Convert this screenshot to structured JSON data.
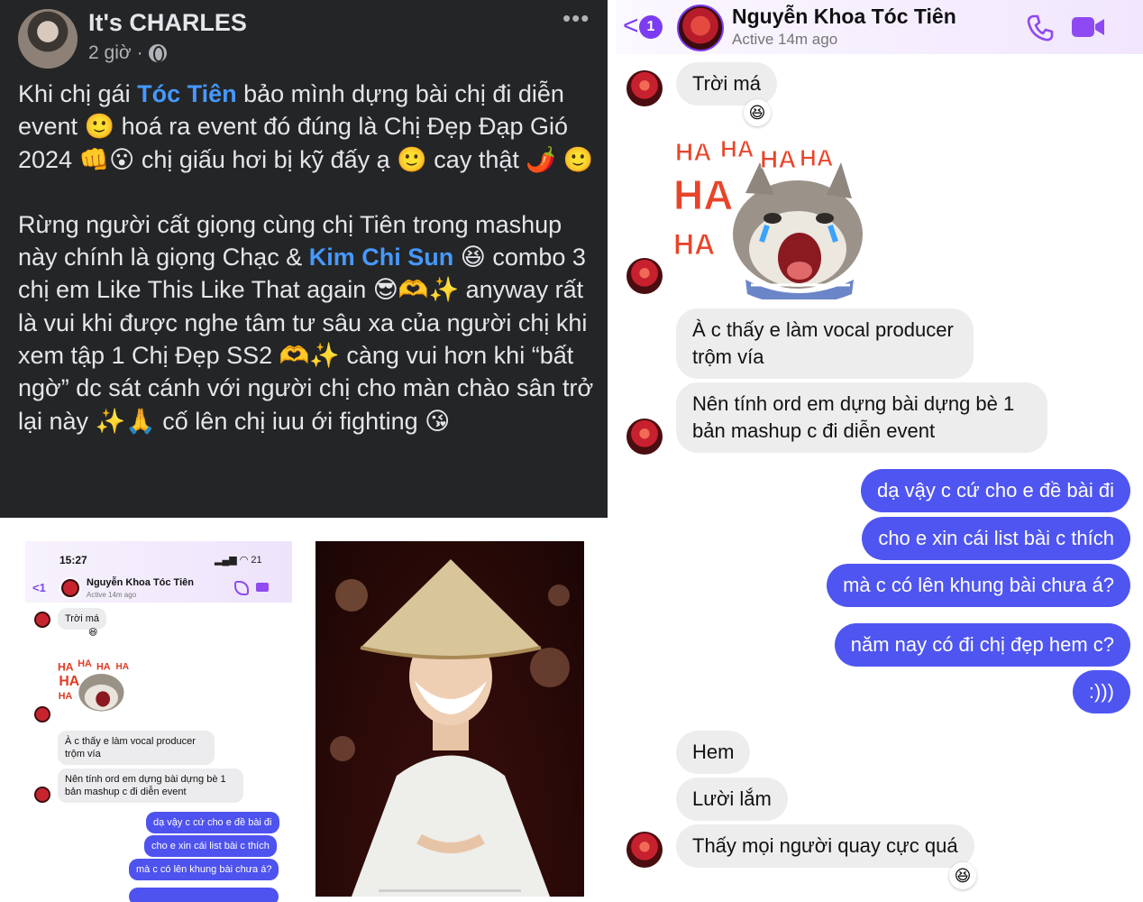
{
  "post": {
    "author": "It's CHARLES",
    "time": "2 giờ",
    "dot": "·",
    "more": "•••",
    "p1": {
      "t1": "Khi chị gái ",
      "tag1": "Tóc Tiên",
      "t2": " bảo mình dựng bài chị đi diễn event 🙂 hoá ra event đó đúng là Chị Đẹp Đạp Gió 2024 👊😮 chị giấu hơi bị kỹ đấy ạ 🙂 cay thật 🌶️ 🙂"
    },
    "p2": {
      "t1": "Rừng người cất giọng cùng chị Tiên trong mashup này chính là giọng Chạc & ",
      "tag2": "Kim Chi Sun",
      "t2": " 😆 combo 3 chị em Like This Like That again 😎🫶✨ anyway rất là vui khi được nghe tâm tư sâu xa của người chị khi xem tập 1 Chị Đẹp SS2 🫶✨ càng vui hơn khi “bất ngờ” dc sát cánh với người chị cho màn chào sân trở lại này ✨🙏 cố lên chị iuu ới fighting 😘"
    }
  },
  "mini": {
    "time": "15:27",
    "status": "▂▄▆ ◠ 21",
    "back": "<1",
    "name": "Nguyễn Khoa Tóc Tiên",
    "active": "Active 14m ago",
    "messages": [
      "Trời má",
      "À c thấy e làm vocal producer trộm vía",
      "Nên tính ord em dựng bài dựng bè 1 bản mashup c đi diễn event",
      "dạ vậy c cứ cho e đề bài đi",
      "cho e xin cái list bài c thích",
      "mà c có lên khung bài chưa á?"
    ],
    "sticker_text": [
      "HA",
      "HA",
      "HA",
      "HA",
      "HA",
      "HA"
    ]
  },
  "messenger": {
    "back_badge": "1",
    "name": "Nguyễn Khoa Tóc Tiên",
    "active": "Active 14m ago",
    "sticker_text": [
      "HA",
      "HA",
      "HA",
      "HA",
      "HA",
      "HA"
    ],
    "messages": [
      {
        "dir": "in",
        "text": "Trời má"
      },
      {
        "dir": "in",
        "text": "À c thấy e làm vocal producer\ntrộm vía"
      },
      {
        "dir": "in",
        "text": "Nên tính ord em dựng bài dựng bè 1\nbản mashup c đi diễn event"
      },
      {
        "dir": "out",
        "text": "dạ vậy c cứ cho e đề bài đi"
      },
      {
        "dir": "out",
        "text": "cho e xin cái list bài c thích"
      },
      {
        "dir": "out",
        "text": "mà c có lên khung bài chưa á?"
      },
      {
        "dir": "out",
        "text": "năm nay có đi chị đẹp hem c?"
      },
      {
        "dir": "out",
        "text": ":)))"
      },
      {
        "dir": "in",
        "text": "Hem"
      },
      {
        "dir": "in",
        "text": "Lười lắm"
      },
      {
        "dir": "in",
        "text": "Thấy mọi người quay cực quá"
      }
    ],
    "reactions": [
      "😆",
      "😆"
    ]
  },
  "colors": {
    "fb_bg": "#242526",
    "tag_blue": "#4599ff",
    "messenger_purple": "#7c3cf2",
    "outgoing_bubble": "#4f55f0",
    "incoming_bubble": "#ededed"
  }
}
